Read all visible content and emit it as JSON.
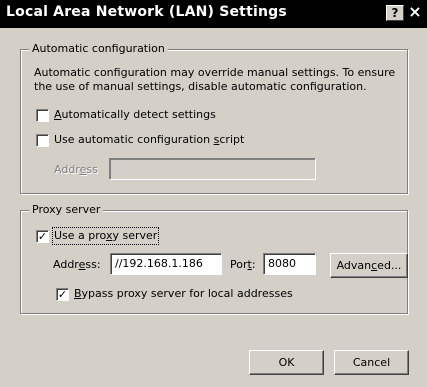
{
  "window": {
    "title": "Local Area Network (LAN) Settings",
    "help_button": "?",
    "close_button": "×"
  },
  "auto_config": {
    "group_label": "Automatic configuration",
    "description_line1": "Automatic configuration may override manual settings.  To ensure",
    "description_line2": "the use of manual settings, disable automatic configuration.",
    "detect_settings": {
      "label_pre": "",
      "label_ul": "A",
      "label_post": "utomatically detect settings",
      "checked": false
    },
    "use_script": {
      "label_pre": "Use automatic configuration ",
      "label_ul": "s",
      "label_post": "cript",
      "checked": false
    },
    "address_label_pre": "Addr",
    "address_label_ul": "e",
    "address_label_post": "ss",
    "address_value": ""
  },
  "proxy": {
    "group_label": "Proxy server",
    "use_proxy": {
      "label_pre": "Use a pro",
      "label_ul": "x",
      "label_post": "y server",
      "checked": true
    },
    "address_label_pre": "Addr",
    "address_label_ul": "e",
    "address_label_post": "ss:",
    "address_value": "//192.168.1.186",
    "port_label_pre": "Por",
    "port_label_ul": "t",
    "port_label_post": ":",
    "port_value": "8080",
    "advanced_label_pre": "Advan",
    "advanced_label_ul": "c",
    "advanced_label_post": "ed...",
    "bypass": {
      "label_pre": "",
      "label_ul": "B",
      "label_post": "ypass proxy server for local addresses",
      "checked": true
    }
  },
  "buttons": {
    "ok": "OK",
    "cancel": "Cancel"
  },
  "check_glyph": "✓"
}
